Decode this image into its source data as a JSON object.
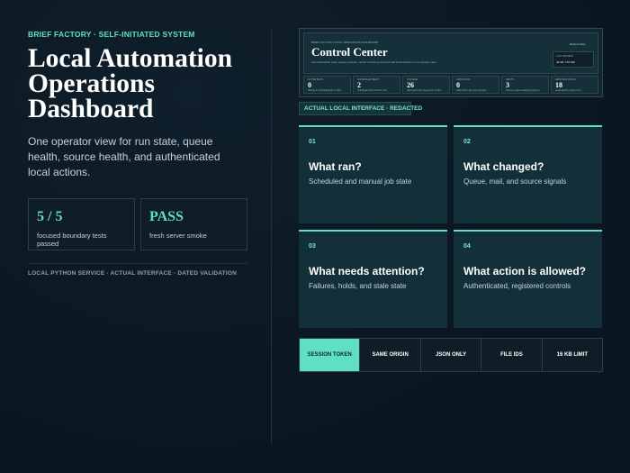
{
  "eyebrow": "BRIEF FACTORY · SELF-INITIATED SYSTEM",
  "title_lines": [
    "Local Automation",
    "Operations",
    "Dashboard"
  ],
  "intro": "One operator view for run state, queue health, source health, and authenticated local actions.",
  "stats": [
    {
      "value": "5 / 5",
      "label": "focused boundary tests passed"
    },
    {
      "value": "PASS",
      "label": "fresh server smoke"
    }
  ],
  "footnote": "LOCAL PYTHON SERVICE · ACTUAL INTERFACE · DATED VALIDATION",
  "screenshot": {
    "eyebrow": "BRIEF FACTORY LOCAL OPERATIONS DASHBOARD",
    "title": "Control Center",
    "subtitle": "Live automation state, queue pressure, record rot history, and secured local actions in one operator view.",
    "refresh": "Refresh Now",
    "box_label": "LAST REFRESH",
    "box_value": "Jul 20, 7:57 AM",
    "metrics": [
      {
        "label": "ACTIVE RUNS",
        "value": "0",
        "desc": "Manual or scheduled jobs in flight"
      },
      {
        "label": "SCHEDULED READY",
        "value": "2",
        "desc": "Schedules that could fire now"
      },
      {
        "label": "IN QUEUE",
        "value": "26",
        "desc": "Approved briefs queued for review"
      },
      {
        "label": "JOBS STUCK",
        "value": "0",
        "desc": "Jobs held in the approval gate"
      },
      {
        "label": "INPUTS",
        "value": "3",
        "desc": "Source records awaiting ingestion"
      },
      {
        "label": "REMOTE ACTIONS",
        "value": "18",
        "desc": "Local actions ready to run"
      }
    ]
  },
  "interface_tag": "ACTUAL LOCAL INTERFACE · REDACTED",
  "cards": [
    {
      "num": "01",
      "title": "What ran?",
      "desc": "Scheduled and manual job state"
    },
    {
      "num": "02",
      "title": "What changed?",
      "desc": "Queue, mail, and source signals"
    },
    {
      "num": "03",
      "title": "What needs attention?",
      "desc": "Failures, holds, and stale state"
    },
    {
      "num": "04",
      "title": "What action is allowed?",
      "desc": "Authenticated, registered controls"
    }
  ],
  "controls": [
    "SESSION TOKEN",
    "SAME ORIGIN",
    "JSON ONLY",
    "FILE IDS",
    "16 KB LIMIT"
  ],
  "colors": {
    "accent": "#5fe0c4",
    "background": "#0b1822",
    "card": "#13303a"
  }
}
